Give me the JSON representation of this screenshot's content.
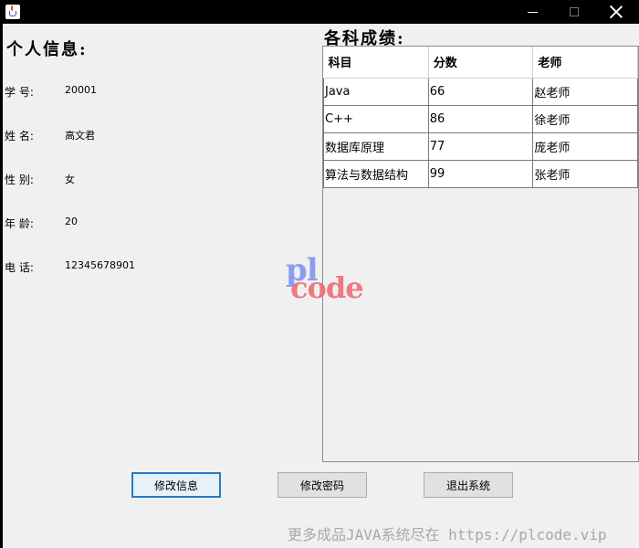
{
  "window": {
    "controls": {
      "minimize_icon": "minimize-icon",
      "maximize_icon": "maximize-icon",
      "close_icon": "close-icon"
    }
  },
  "personal_info": {
    "title": "个人信息:",
    "fields": [
      {
        "label": "学 号:",
        "value": "20001"
      },
      {
        "label": "姓 名:",
        "value": "高文君"
      },
      {
        "label": "性 别:",
        "value": "女"
      },
      {
        "label": "年 龄:",
        "value": "20"
      },
      {
        "label": "电 话:",
        "value": "12345678901"
      }
    ]
  },
  "scores": {
    "title": "各科成绩:",
    "columns": [
      "科目",
      "分数",
      "老师"
    ],
    "rows": [
      [
        "Java",
        "66",
        "赵老师"
      ],
      [
        "C++",
        "86",
        "徐老师"
      ],
      [
        "数据库原理",
        "77",
        "庞老师"
      ],
      [
        "算法与数据结构",
        "99",
        "张老师"
      ]
    ]
  },
  "logo": {
    "line1": "pl",
    "line2": "code"
  },
  "buttons": {
    "edit_info": "修改信息",
    "change_password": "修改密码",
    "exit": "退出系统"
  },
  "footer": {
    "watermark": "更多成品JAVA系统尽在 https://plcode.vip"
  },
  "colors": {
    "accent": "#2b78c5",
    "logo_blue": "#7a8ff0",
    "logo_red": "#ee6d74"
  }
}
